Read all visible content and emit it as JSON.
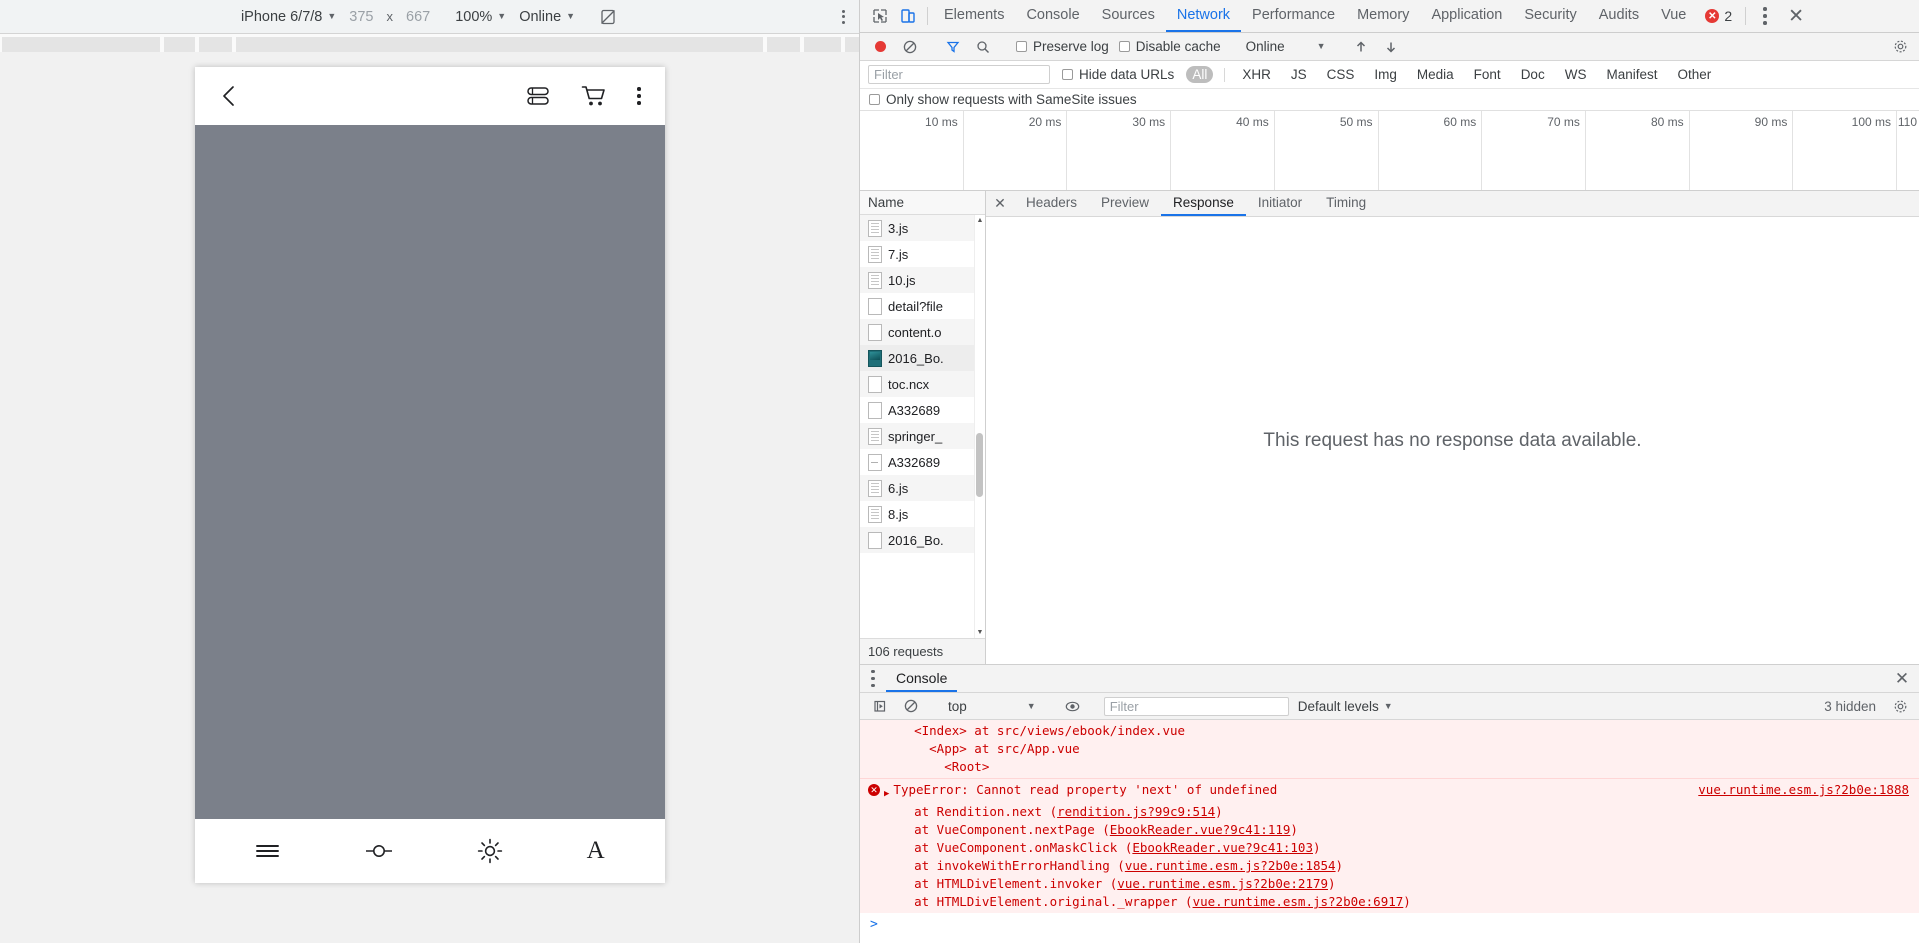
{
  "emulator": {
    "device": "iPhone 6/7/8",
    "width": "375",
    "x_sep": "x",
    "height": "667",
    "zoom": "100%",
    "throttle": "Online",
    "rotate_icon": "rotate-icon",
    "kebab_icon": "more-options-icon"
  },
  "phone_app": {
    "back_icon": "back-chevron-icon",
    "book_icon": "book-shelf-icon",
    "cart_icon": "shopping-cart-icon",
    "menu_icon": "more-vertical-icon",
    "footer": {
      "menu_icon": "hamburger-menu-icon",
      "progress_icon": "progress-circle-icon",
      "brightness_icon": "brightness-sun-icon",
      "font_icon": "font-size-A-icon",
      "font_label": "A"
    }
  },
  "devtools": {
    "inspect_icon": "inspect-element-icon",
    "device_icon": "toggle-device-toolbar-icon",
    "tabs": [
      {
        "label": "Elements",
        "active": false
      },
      {
        "label": "Console",
        "active": false
      },
      {
        "label": "Sources",
        "active": false
      },
      {
        "label": "Network",
        "active": true
      },
      {
        "label": "Performance",
        "active": false
      },
      {
        "label": "Memory",
        "active": false
      },
      {
        "label": "Application",
        "active": false
      },
      {
        "label": "Security",
        "active": false
      },
      {
        "label": "Audits",
        "active": false
      },
      {
        "label": "Vue",
        "active": false
      }
    ],
    "error_count": "2",
    "error_icon": "error-circle-icon",
    "kebab_icon": "customize-devtools-icon",
    "close_icon": "close-devtools-icon",
    "accent": "#1a73e8",
    "error_color": "#e53935"
  },
  "network_toolbar": {
    "record_icon": "record-stop-icon",
    "clear_icon": "clear-network-log-icon",
    "filter_icon": "filter-funnel-icon",
    "search_icon": "search-magnifier-icon",
    "preserve_log": "Preserve log",
    "disable_cache": "Disable cache",
    "throttle": "Online",
    "import_icon": "import-har-icon",
    "export_icon": "export-har-icon",
    "settings_icon": "network-settings-gear-icon"
  },
  "filter_bar": {
    "filter_placeholder": "Filter",
    "filter_value": "",
    "hide_data_urls": "Hide data URLs",
    "types": [
      {
        "label": "All",
        "active": true
      },
      {
        "label": "XHR",
        "active": false
      },
      {
        "label": "JS",
        "active": false
      },
      {
        "label": "CSS",
        "active": false
      },
      {
        "label": "Img",
        "active": false
      },
      {
        "label": "Media",
        "active": false
      },
      {
        "label": "Font",
        "active": false
      },
      {
        "label": "Doc",
        "active": false
      },
      {
        "label": "WS",
        "active": false
      },
      {
        "label": "Manifest",
        "active": false
      },
      {
        "label": "Other",
        "active": false
      }
    ],
    "samesite_label": "Only show requests with SameSite issues"
  },
  "timeline": {
    "ticks": [
      "10 ms",
      "20 ms",
      "30 ms",
      "40 ms",
      "50 ms",
      "60 ms",
      "70 ms",
      "80 ms",
      "90 ms",
      "100 ms",
      "110"
    ]
  },
  "requests": {
    "column_header": "Name",
    "rows": [
      {
        "name": "3.js",
        "icon": "js-file-icon",
        "kind": "doc",
        "selected": false
      },
      {
        "name": "7.js",
        "icon": "js-file-icon",
        "kind": "doc",
        "selected": false
      },
      {
        "name": "10.js",
        "icon": "js-file-icon",
        "kind": "doc",
        "selected": false
      },
      {
        "name": "detail?file",
        "icon": "document-file-icon",
        "kind": "plain",
        "selected": false
      },
      {
        "name": "content.o",
        "icon": "document-file-icon",
        "kind": "plain",
        "selected": false
      },
      {
        "name": "2016_Bo.",
        "icon": "image-file-icon",
        "kind": "img",
        "selected": true
      },
      {
        "name": "toc.ncx",
        "icon": "document-file-icon",
        "kind": "plain",
        "selected": false
      },
      {
        "name": "A332689",
        "icon": "document-file-icon",
        "kind": "plain",
        "selected": false
      },
      {
        "name": "springer_",
        "icon": "js-file-icon",
        "kind": "doc",
        "selected": false
      },
      {
        "name": "A332689",
        "icon": "text-file-icon",
        "kind": "txt",
        "selected": false
      },
      {
        "name": "6.js",
        "icon": "js-file-icon",
        "kind": "doc",
        "selected": false
      },
      {
        "name": "8.js",
        "icon": "js-file-icon",
        "kind": "doc",
        "selected": false
      },
      {
        "name": "2016_Bo.",
        "icon": "document-file-icon",
        "kind": "plain",
        "selected": false
      }
    ],
    "footer": "106 requests",
    "scroll_up_icon": "scroll-up-arrow-icon",
    "scroll_down_icon": "scroll-down-arrow-icon"
  },
  "detail": {
    "close_icon": "close-detail-icon",
    "tabs": [
      {
        "label": "Headers",
        "active": false
      },
      {
        "label": "Preview",
        "active": false
      },
      {
        "label": "Response",
        "active": true
      },
      {
        "label": "Initiator",
        "active": false
      },
      {
        "label": "Timing",
        "active": false
      }
    ],
    "empty_message": "This request has no response data available."
  },
  "console": {
    "kebab_icon": "drawer-more-icon",
    "tab_label": "Console",
    "close_icon": "close-drawer-icon",
    "execute_icon": "execute-snippet-icon",
    "clear_icon": "clear-console-icon",
    "context": "top",
    "eye_icon": "live-expression-icon",
    "filter_placeholder": "Filter",
    "filter_value": "",
    "levels": "Default levels",
    "hidden": "3 hidden",
    "settings_icon": "console-settings-gear-icon",
    "trace_head": [
      "    <Index> at src/views/ebook/index.vue",
      "      <App> at src/App.vue",
      "        <Root>"
    ],
    "error_title": "TypeError: Cannot read property 'next' of undefined",
    "error_source": "vue.runtime.esm.js?2b0e:1888",
    "stack": [
      {
        "text": "    at Rendition.next (",
        "link": "rendition.js?99c9:514",
        "tail": ")"
      },
      {
        "text": "    at VueComponent.nextPage (",
        "link": "EbookReader.vue?9c41:119",
        "tail": ")"
      },
      {
        "text": "    at VueComponent.onMaskClick (",
        "link": "EbookReader.vue?9c41:103",
        "tail": ")"
      },
      {
        "text": "    at invokeWithErrorHandling (",
        "link": "vue.runtime.esm.js?2b0e:1854",
        "tail": ")"
      },
      {
        "text": "    at HTMLDivElement.invoker (",
        "link": "vue.runtime.esm.js?2b0e:2179",
        "tail": ")"
      },
      {
        "text": "    at HTMLDivElement.original._wrapper (",
        "link": "vue.runtime.esm.js?2b0e:6917",
        "tail": ")"
      }
    ],
    "prompt": ">"
  }
}
